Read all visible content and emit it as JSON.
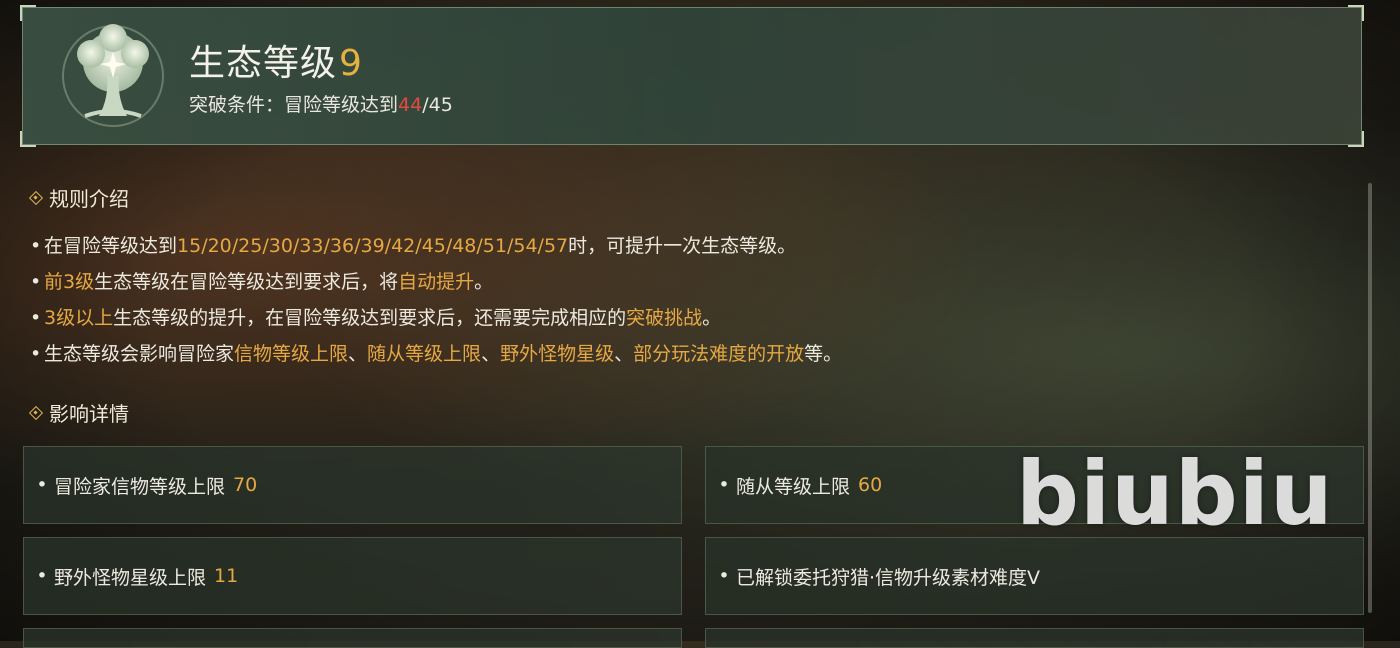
{
  "header": {
    "title": "生态等级",
    "level": "9",
    "condition_prefix": "突破条件：冒险等级达到",
    "condition_current": "44",
    "condition_sep": "/",
    "condition_target": "45"
  },
  "rules_section": {
    "title": "规则介绍",
    "rules": [
      [
        {
          "t": "在冒险等级达到",
          "hl": false
        },
        {
          "t": "15/20/25/30/33/36/39/42/45/48/51/54/57",
          "hl": true
        },
        {
          "t": "时，可提升一次生态等级。",
          "hl": false
        }
      ],
      [
        {
          "t": "前3级",
          "hl": true
        },
        {
          "t": "生态等级在冒险等级达到要求后，将",
          "hl": false
        },
        {
          "t": "自动提升",
          "hl": true
        },
        {
          "t": "。",
          "hl": false
        }
      ],
      [
        {
          "t": "3级以上",
          "hl": true
        },
        {
          "t": "生态等级的提升，在冒险等级达到要求后，还需要完成相应的",
          "hl": false
        },
        {
          "t": "突破挑战",
          "hl": true
        },
        {
          "t": "。",
          "hl": false
        }
      ],
      [
        {
          "t": "生态等级会影响冒险家",
          "hl": false
        },
        {
          "t": "信物等级上限",
          "hl": true
        },
        {
          "t": "、",
          "hl": false
        },
        {
          "t": "随从等级上限",
          "hl": true
        },
        {
          "t": "、",
          "hl": false
        },
        {
          "t": "野外怪物星级",
          "hl": true
        },
        {
          "t": "、",
          "hl": false
        },
        {
          "t": "部分玩法难度的开放",
          "hl": true
        },
        {
          "t": "等。",
          "hl": false
        }
      ]
    ]
  },
  "effects_section": {
    "title": "影响详情",
    "cards": [
      {
        "label": "冒险家信物等级上限",
        "value": "70"
      },
      {
        "label": "随从等级上限",
        "value": "60"
      },
      {
        "label": "野外怪物星级上限",
        "value": "11"
      },
      {
        "label": "已解锁委托狩猎·信物升级素材难度V",
        "value": ""
      }
    ]
  },
  "bullet": "•",
  "watermark": "biubiu",
  "colors": {
    "highlight": "#e6a843",
    "level": "#e6b13e",
    "warning": "#e24a3f",
    "panel": "#3a5042"
  },
  "icons": {
    "emblem": "tree-emblem-icon",
    "section": "diamond-icon"
  }
}
